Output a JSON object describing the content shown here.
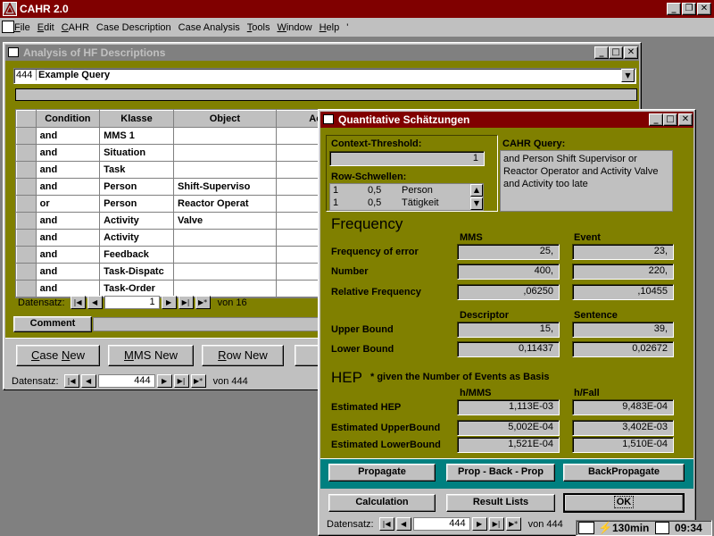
{
  "app": {
    "title": "CAHR 2.0",
    "menu": [
      {
        "label": "File",
        "hot": "F",
        "rest": "ile"
      },
      {
        "label": "Edit",
        "hot": "E",
        "rest": "dit"
      },
      {
        "label": "CAHR",
        "hot": "C",
        "rest": "AHR"
      },
      {
        "label": "Case Description",
        "hot": "",
        "rest": "Case Description"
      },
      {
        "label": "Case Analysis",
        "hot": "",
        "rest": "Case Analysis"
      },
      {
        "label": "Tools",
        "hot": "T",
        "rest": "ools"
      },
      {
        "label": "Window",
        "hot": "W",
        "rest": "indow"
      },
      {
        "label": "Help",
        "hot": "H",
        "rest": "elp"
      }
    ],
    "menu_extra": "'"
  },
  "analysis": {
    "title": "Analysis of HF Descriptions",
    "query_id": "444",
    "query_name": "Example Query",
    "columns": [
      "Condition",
      "Klasse",
      "Object",
      "Action"
    ],
    "rows": [
      [
        "and",
        "MMS 1",
        "",
        ""
      ],
      [
        "and",
        "Situation",
        "",
        ""
      ],
      [
        "and",
        "Task",
        "",
        ""
      ],
      [
        "and",
        "Person",
        "Shift-Superviso",
        ""
      ],
      [
        "or",
        "Person",
        "Reactor Operat",
        ""
      ],
      [
        "and",
        "Activity",
        "Valve",
        ""
      ],
      [
        "and",
        "Activity",
        "",
        ""
      ],
      [
        "and",
        "Feedback",
        "",
        ""
      ],
      [
        "and",
        "Task-Dispatc",
        "",
        ""
      ],
      [
        "and",
        "Task-Order",
        "",
        ""
      ]
    ],
    "inner_nav": {
      "label": "Datensatz:",
      "record": "1",
      "of": "von  16"
    },
    "comment_label": "Comment",
    "buttons": {
      "case_new": "Case New",
      "mms_new": "MMS New",
      "row_new": "Row New"
    },
    "outer_nav": {
      "label": "Datensatz:",
      "record": "444",
      "of": "von  444"
    }
  },
  "quant": {
    "title": "Quantitative Schätzungen",
    "context_threshold_label": "Context-Threshold:",
    "context_threshold_value": "1",
    "row_schwellen_label": "Row-Schwellen:",
    "row_schwellen": [
      {
        "n": "1",
        "v": "0,5",
        "name": "Person"
      },
      {
        "n": "1",
        "v": "0,5",
        "name": "Tätigkeit"
      }
    ],
    "cahr_query_label": "CAHR Query:",
    "cahr_query_text": "and Person Shift Supervisor or Reactor Operator and Activity Valve and Activity too late",
    "frequency_heading": "Frequency",
    "col_mms": "MMS",
    "col_event": "Event",
    "freq_error_label": "Frequency of error",
    "freq_error_mms": "25,",
    "freq_error_event": "23,",
    "number_label": "Number",
    "number_mms": "400,",
    "number_event": "220,",
    "rel_freq_label": "Relative Frequency",
    "rel_freq_mms": ",06250",
    "rel_freq_event": ",10455",
    "col_descriptor": "Descriptor",
    "col_sentence": "Sentence",
    "upper_bound_label": "Upper Bound",
    "upper_bound_desc": "15,",
    "upper_bound_sent": "39,",
    "lower_bound_label": "Lower Bound",
    "lower_bound_desc": "0,11437",
    "lower_bound_sent": "0,02672",
    "hep_heading": "HEP",
    "hep_note": "* given the Number of Events as Basis",
    "col_h_mms": "h/MMS",
    "col_h_fall": "h/Fall",
    "est_hep_label": "Estimated HEP",
    "est_hep_mms": "1,113E-03",
    "est_hep_fall": "9,483E-04",
    "est_upper_label": "Estimated UpperBound",
    "est_upper_mms": "5,002E-04",
    "est_upper_fall": "3,402E-03",
    "est_lower_label": "Estimated LowerBound",
    "est_lower_mms": "1,521E-04",
    "est_lower_fall": "1,510E-04",
    "btn_propagate": "Propagate",
    "btn_prop_back_prop": "Prop - Back - Prop",
    "btn_backpropagate": "BackPropagate",
    "btn_calculation": "Calculation",
    "btn_result_lists": "Result Lists",
    "btn_ok": "OK",
    "nav": {
      "label": "Datensatz:",
      "record": "444",
      "of": "von  444"
    }
  },
  "taskbar": {
    "zoom": "130min",
    "clock": "09:34"
  },
  "colors": {
    "titlebar": "#800000",
    "olive": "#808000",
    "teal": "#008080"
  }
}
